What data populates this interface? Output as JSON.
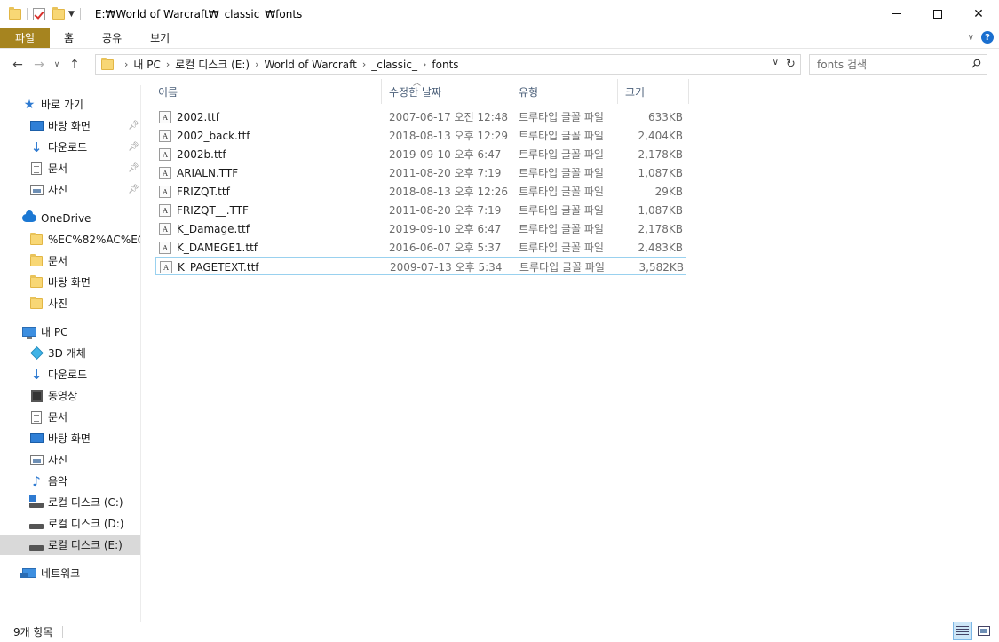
{
  "window": {
    "title": "E:₩World of Warcraft₩_classic_₩fonts",
    "minimize": "minimize",
    "maximize": "maximize",
    "close": "✕"
  },
  "ribbon": {
    "tabs": [
      "파일",
      "홈",
      "공유",
      "보기"
    ]
  },
  "nav": {
    "breadcrumbs": [
      "내 PC",
      "로컬 디스크 (E:)",
      "World of Warcraft",
      "_classic_",
      "fonts"
    ],
    "search_placeholder": "fonts 검색"
  },
  "sidebar": {
    "quick_access": "바로 가기",
    "quick_items": [
      "바탕 화면",
      "다운로드",
      "문서",
      "사진"
    ],
    "onedrive": "OneDrive",
    "onedrive_items": [
      "%EC%82%AC%EC%",
      "문서",
      "바탕 화면",
      "사진"
    ],
    "this_pc": "내 PC",
    "pc_items": [
      "3D 개체",
      "다운로드",
      "동영상",
      "문서",
      "바탕 화면",
      "사진",
      "음악",
      "로컬 디스크 (C:)",
      "로컬 디스크 (D:)",
      "로컬 디스크 (E:)"
    ],
    "network": "네트워크"
  },
  "columns": {
    "name": "이름",
    "date": "수정한 날짜",
    "type": "유형",
    "size": "크기"
  },
  "files": [
    {
      "name": "2002.ttf",
      "date": "2007-06-17 오전 12:48",
      "type": "트루타입 글꼴 파일",
      "size": "633KB"
    },
    {
      "name": "2002_back.ttf",
      "date": "2018-08-13 오후 12:29",
      "type": "트루타입 글꼴 파일",
      "size": "2,404KB"
    },
    {
      "name": "2002b.ttf",
      "date": "2019-09-10 오후 6:47",
      "type": "트루타입 글꼴 파일",
      "size": "2,178KB"
    },
    {
      "name": "ARIALN.TTF",
      "date": "2011-08-20 오후 7:19",
      "type": "트루타입 글꼴 파일",
      "size": "1,087KB"
    },
    {
      "name": "FRIZQT.ttf",
      "date": "2018-08-13 오후 12:26",
      "type": "트루타입 글꼴 파일",
      "size": "29KB"
    },
    {
      "name": "FRIZQT__.TTF",
      "date": "2011-08-20 오후 7:19",
      "type": "트루타입 글꼴 파일",
      "size": "1,087KB"
    },
    {
      "name": "K_Damage.ttf",
      "date": "2019-09-10 오후 6:47",
      "type": "트루타입 글꼴 파일",
      "size": "2,178KB"
    },
    {
      "name": "K_DAMEGE1.ttf",
      "date": "2016-06-07 오후 5:37",
      "type": "트루타입 글꼴 파일",
      "size": "2,483KB"
    },
    {
      "name": "K_PAGETEXT.ttf",
      "date": "2009-07-13 오후 5:34",
      "type": "트루타입 글꼴 파일",
      "size": "3,582KB"
    }
  ],
  "status": {
    "count": "9개 항목"
  },
  "colors": {
    "file_tab": "#a6841f",
    "selection_border": "#99d1ef",
    "accent": "#1a6fcf"
  }
}
